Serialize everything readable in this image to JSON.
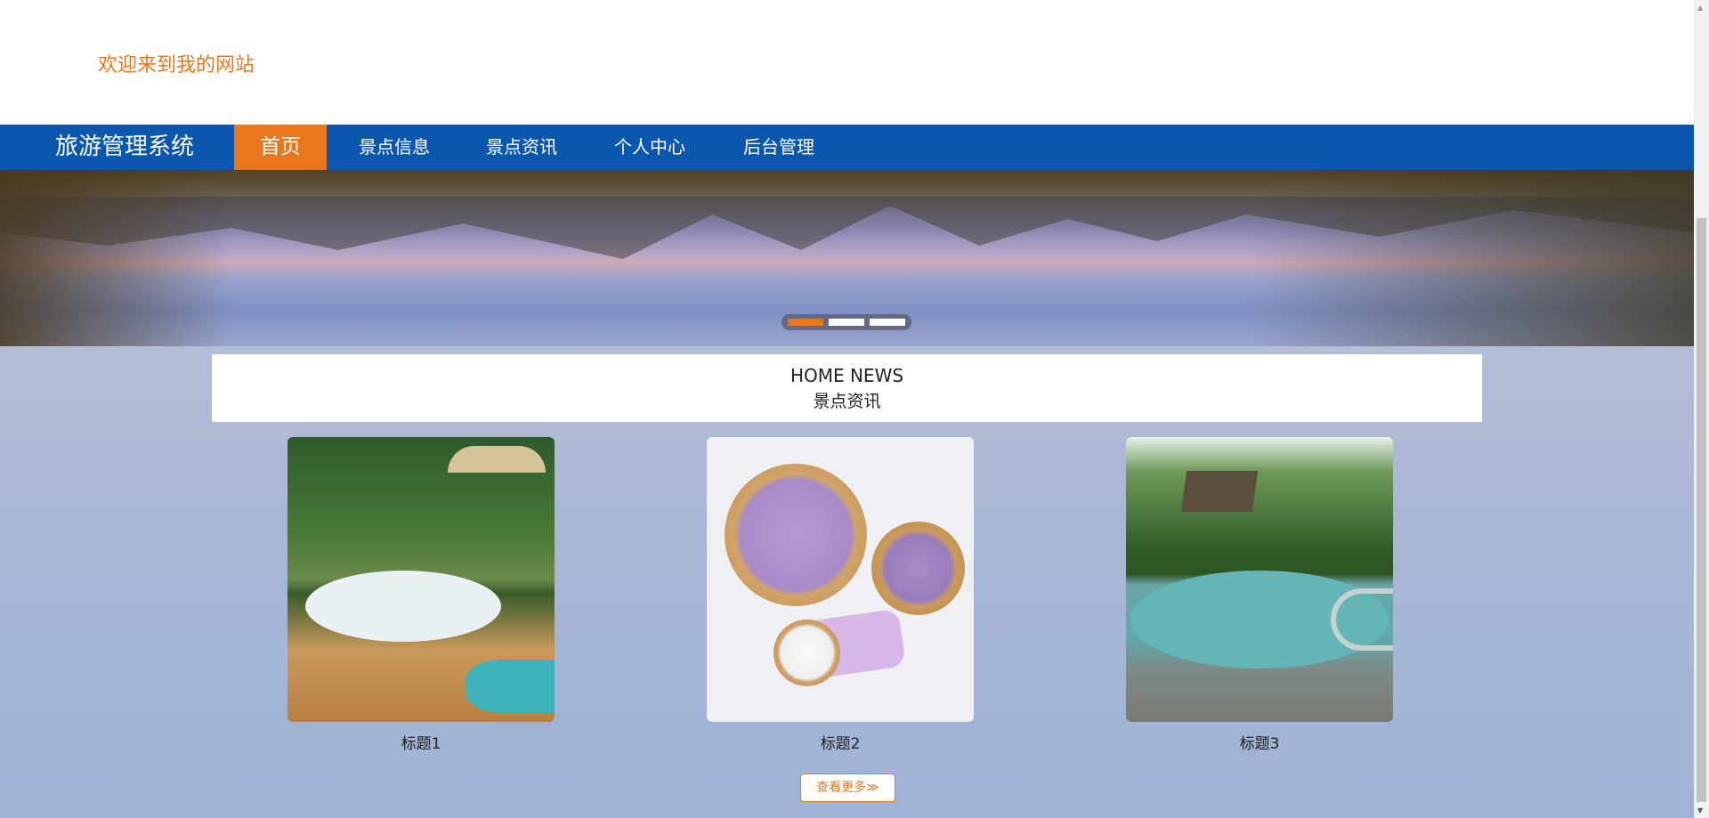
{
  "header": {
    "welcome": "欢迎来到我的网站"
  },
  "nav": {
    "brand": "旅游管理系统",
    "items": [
      {
        "label": "首页",
        "active": true
      },
      {
        "label": "景点信息",
        "active": false
      },
      {
        "label": "景点资讯",
        "active": false
      },
      {
        "label": "个人中心",
        "active": false
      },
      {
        "label": "后台管理",
        "active": false
      }
    ]
  },
  "carousel": {
    "slide_count": 3,
    "active_index": 0
  },
  "news": {
    "title_en": "HOME NEWS",
    "title_cn": "景点资讯",
    "cards": [
      {
        "caption": "标题1"
      },
      {
        "caption": "标题2"
      },
      {
        "caption": "标题3"
      }
    ],
    "more_label": "查看更多≫"
  },
  "colors": {
    "accent": "#e8771d",
    "nav_bg": "#0b57ad"
  }
}
